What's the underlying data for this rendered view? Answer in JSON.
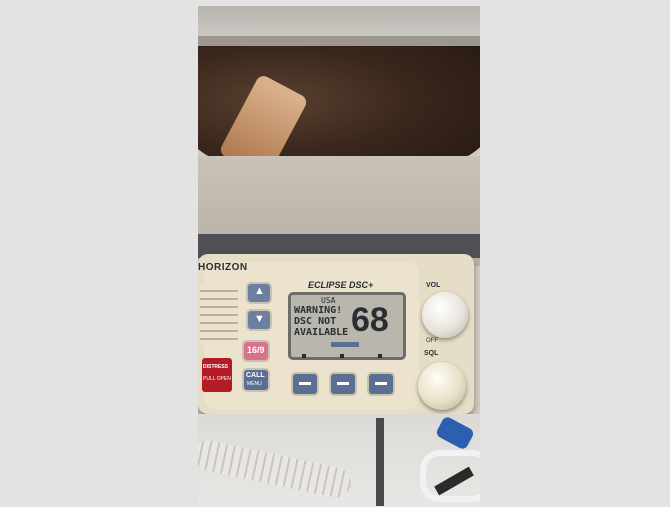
{
  "radio": {
    "brand": "HORIZON",
    "model": "ECLIPSE DSC+",
    "vol_label": "VOL",
    "off_label": "OFF",
    "sql_label": "SQL",
    "up_button_glyph": "▲",
    "down_button_glyph": "▼",
    "channel_16_9_label": "16/9",
    "call_label": "CALL",
    "menu_label": "MENU",
    "distress_label": "DISTRESS",
    "pull_open_label": "PULL OPEN",
    "lcd": {
      "region_text": "USA",
      "line1": "WARNING!",
      "line2": "DSC NOT",
      "line3": "AVAILABLE",
      "channel": "68"
    }
  },
  "colors": {
    "background": "#e3e3e3",
    "radio_body": "#e6ddc6",
    "lcd_bg": "#b8b6ad",
    "lcd_text": "#2b2d33",
    "soft_key": "#5b6e93",
    "distress_red": "#b21c26",
    "channel_key_pink": "#d9708c"
  },
  "icons": {
    "up": "up-arrow-icon",
    "down": "down-arrow-icon"
  }
}
